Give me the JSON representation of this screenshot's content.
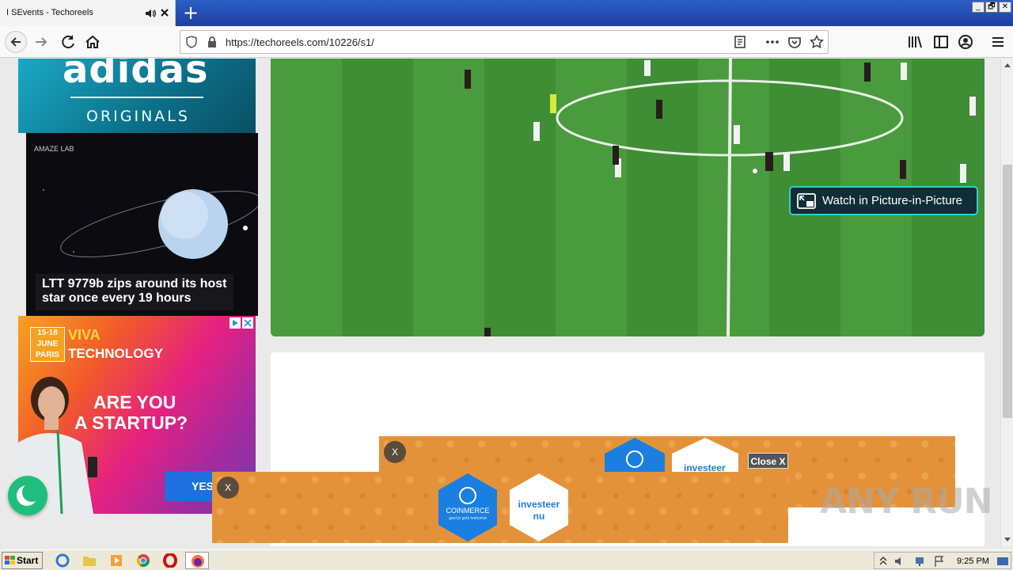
{
  "browser": {
    "tab_title": "I SEvents - Techoreels",
    "new_tab_label": "+",
    "url": "https://techoreels.com/10226/s1/",
    "window_buttons": [
      "_",
      "🗗",
      "✕"
    ]
  },
  "ads": {
    "adidas": {
      "logo": "adidas",
      "subtitle": "ORIGINALS"
    },
    "space": {
      "brand": "AMAZE LAB",
      "headline": "LTT 9779b zips around its host star once every 19 hours"
    },
    "viva": {
      "date_line1": "15-18",
      "date_line2": "JUNE",
      "date_line3": "PARIS",
      "brand": "VIVA",
      "tech": "TECHNOLOGY",
      "question_line1": "ARE YOU",
      "question_line2": "A STARTUP?",
      "cta": "YES"
    },
    "coinmerce": {
      "close_x": "X",
      "brand": "COINMERCE",
      "tagline": "geef je geld toekomst",
      "invest_line1": "investeer",
      "invest_line2": "nu",
      "close_button": "Close X"
    }
  },
  "video": {
    "pip_label": "Watch in Picture-in-Picture"
  },
  "watermark": "ANY RUN",
  "taskbar": {
    "start_label": "Start",
    "clock": "9:25 PM"
  },
  "colors": {
    "pitch": "#3f8d35",
    "pip_border": "#2ecfd2",
    "banner": "#e49239",
    "coinmerce_blue": "#1a7fe0"
  }
}
